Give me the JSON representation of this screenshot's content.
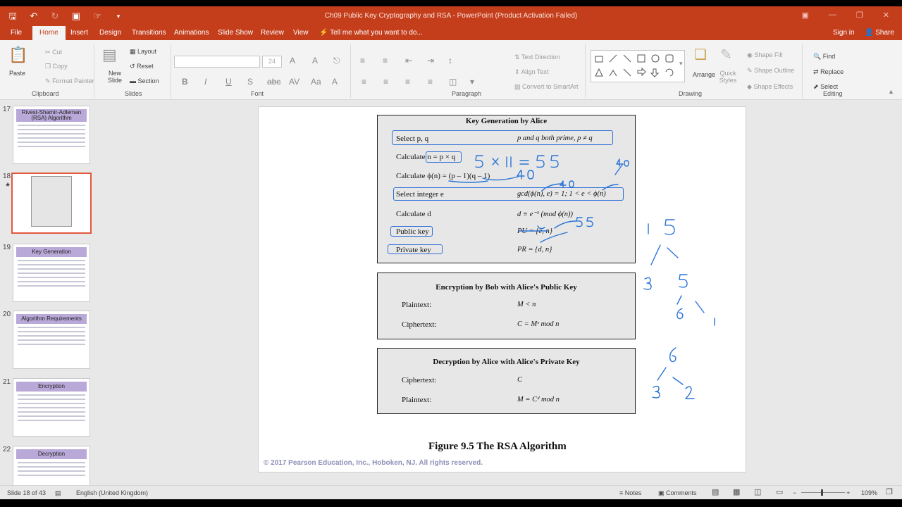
{
  "window": {
    "title": "Ch09 Public Key Cryptography and RSA - PowerPoint (Product Activation Failed)"
  },
  "ribbon_tabs": [
    "File",
    "Home",
    "Insert",
    "Design",
    "Transitions",
    "Animations",
    "Slide Show",
    "Review",
    "View"
  ],
  "tell_me": "Tell me what you want to do...",
  "account": {
    "signin": "Sign in",
    "share": "Share"
  },
  "ribbon": {
    "clipboard": {
      "label": "Clipboard",
      "paste": "Paste",
      "cut": "Cut",
      "copy": "Copy",
      "format_painter": "Format Painter"
    },
    "slides": {
      "label": "Slides",
      "new_slide": "New Slide",
      "layout": "Layout",
      "reset": "Reset",
      "section": "Section"
    },
    "font": {
      "label": "Font",
      "size": "24"
    },
    "paragraph": {
      "label": "Paragraph",
      "text_direction": "Text Direction",
      "align_text": "Align Text",
      "convert_smartart": "Convert to SmartArt"
    },
    "drawing": {
      "label": "Drawing",
      "arrange": "Arrange",
      "quick_styles": "Quick Styles",
      "shape_fill": "Shape Fill",
      "shape_outline": "Shape Outline",
      "shape_effects": "Shape Effects"
    },
    "editing": {
      "label": "Editing",
      "find": "Find",
      "replace": "Replace",
      "select": "Select"
    }
  },
  "thumbnails": [
    {
      "num": "17",
      "title": "Rivest-Shamir-Adleman (RSA) Algorithm"
    },
    {
      "num": "18",
      "title": ""
    },
    {
      "num": "19",
      "title": "Key Generation"
    },
    {
      "num": "20",
      "title": "Algorithm Requirements"
    },
    {
      "num": "21",
      "title": "Encryption"
    },
    {
      "num": "22",
      "title": "Decryption"
    }
  ],
  "slide": {
    "keygen": {
      "title": "Key Generation by Alice",
      "rows": [
        {
          "left": "Select p, q",
          "right": "p and q both prime, p ≠ q"
        },
        {
          "left": "Calculate n = p × q",
          "right": ""
        },
        {
          "left": "Calculate ϕ(n) = (p – 1)(q – 1)",
          "right": ""
        },
        {
          "left": "Select integer e",
          "right": "gcd(ϕ(n), e) = 1;  1 < e < ϕ(n)"
        },
        {
          "left": "Calculate d",
          "right": "d ≡ e⁻¹ (mod ϕ(n))"
        },
        {
          "left": "Public key",
          "right": "PU = {e, n}"
        },
        {
          "left": "Private key",
          "right": "PR = {d, n}"
        }
      ]
    },
    "encryption": {
      "title": "Encryption by Bob with Alice's Public Key",
      "rows": [
        {
          "left": "Plaintext:",
          "right": "M < n"
        },
        {
          "left": "Ciphertext:",
          "right": "C = Mᵉ mod n"
        }
      ]
    },
    "decryption": {
      "title": "Decryption by Alice with Alice's Private Key",
      "rows": [
        {
          "left": "Ciphertext:",
          "right": "C"
        },
        {
          "left": "Plaintext:",
          "right": "M = Cᵈ mod n"
        }
      ]
    },
    "caption": "Figure 9.5  The RSA Algorithm",
    "copyright": "© 2017 Pearson Education, Inc., Hoboken, NJ. All rights reserved.",
    "ink_color": "#2a74d6"
  },
  "statusbar": {
    "slide_info": "Slide 18 of 43",
    "language": "English (United Kingdom)",
    "notes": "Notes",
    "comments": "Comments",
    "zoom": "109%"
  },
  "colors": {
    "accent": "#c43e1c",
    "selected_thumb": "#e1593d"
  }
}
